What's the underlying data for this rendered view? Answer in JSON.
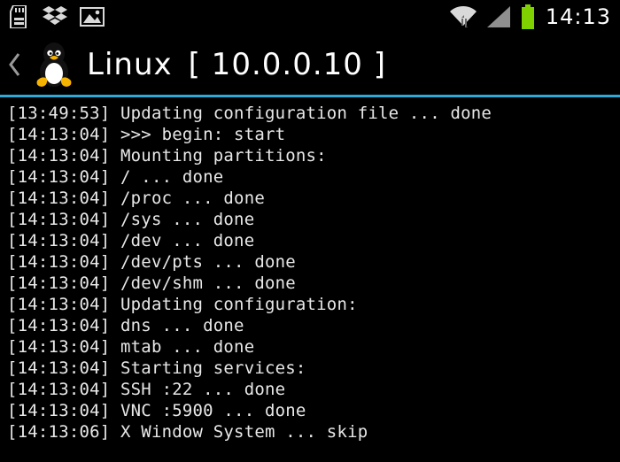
{
  "status": {
    "clock": "14:13",
    "icons": {
      "sdcard": "sd-card-icon",
      "dropbox": "dropbox-icon",
      "picture": "picture-icon",
      "wifi": "wifi-icon",
      "signal": "cell-signal-icon",
      "battery": "battery-icon"
    },
    "battery_color": "#7fd200"
  },
  "title": {
    "name": "Linux",
    "ip": "[ 10.0.0.10 ]"
  },
  "accent_color": "#2eaad8",
  "log": [
    {
      "ts": "[13:49:53]",
      "msg": "Updating configuration file ... done"
    },
    {
      "ts": "[14:13:04]",
      "msg": ">>> begin: start"
    },
    {
      "ts": "[14:13:04]",
      "msg": "Mounting partitions:"
    },
    {
      "ts": "[14:13:04]",
      "msg": "/ ... done"
    },
    {
      "ts": "[14:13:04]",
      "msg": "/proc ... done"
    },
    {
      "ts": "[14:13:04]",
      "msg": "/sys ... done"
    },
    {
      "ts": "[14:13:04]",
      "msg": "/dev ... done"
    },
    {
      "ts": "[14:13:04]",
      "msg": "/dev/pts ... done"
    },
    {
      "ts": "[14:13:04]",
      "msg": "/dev/shm ... done"
    },
    {
      "ts": "[14:13:04]",
      "msg": "Updating configuration:"
    },
    {
      "ts": "[14:13:04]",
      "msg": "dns ... done"
    },
    {
      "ts": "[14:13:04]",
      "msg": "mtab ... done"
    },
    {
      "ts": "[14:13:04]",
      "msg": "Starting services:"
    },
    {
      "ts": "[14:13:04]",
      "msg": "SSH :22 ... done"
    },
    {
      "ts": "[14:13:04]",
      "msg": "VNC :5900 ... done"
    },
    {
      "ts": "[14:13:06]",
      "msg": "X Window System ... skip"
    }
  ]
}
